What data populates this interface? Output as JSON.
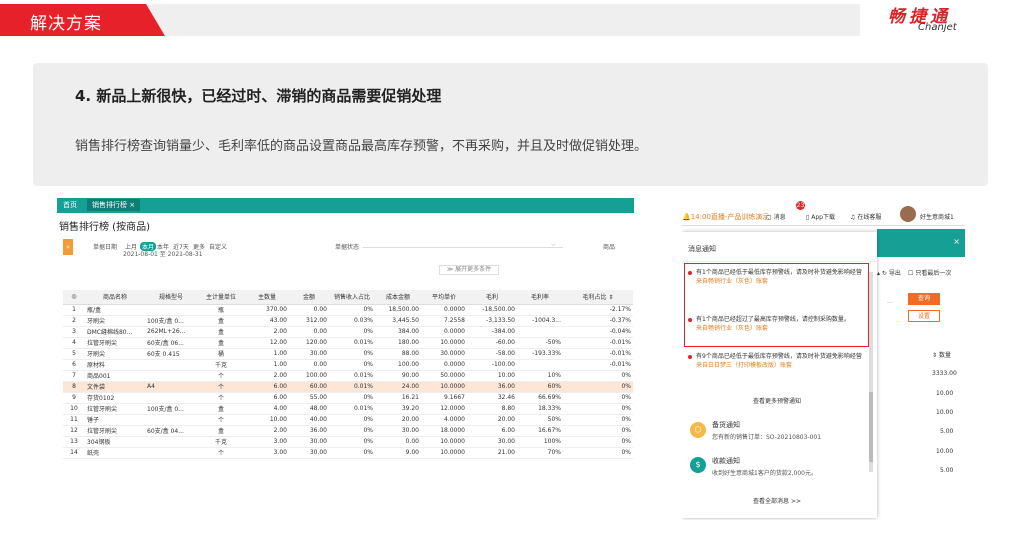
{
  "header": {
    "title": "解决方案",
    "logo_cn": "畅捷通",
    "logo_en": "Chanjet",
    "accent": "#e62129"
  },
  "panel": {
    "heading": "4. 新品上新很快，已经过时、滞销的商品需要促销处理",
    "text": "销售排行榜查询销量少、毛利率低的商品设置商品最高库存预警，不再采购，并且及时做促销处理。"
  },
  "left": {
    "tabs": [
      "首页",
      "销售排行榜 ×"
    ],
    "title": "销售排行榜 (按商品)",
    "filter": {
      "date_label": "单据日期",
      "periods": [
        "上月",
        "本月",
        "本年",
        "近7天",
        "更多",
        "自定义"
      ],
      "range": "2021-08-01 至 2021-08-31",
      "status_label": "单据状态",
      "goods_label": "商品",
      "more": "≫ 展开更多条件"
    },
    "columns": [
      "◎",
      "商品名称",
      "规格型号",
      "主计量单位",
      "主数量",
      "金额",
      "销售收入占比",
      "成本金额",
      "平均单价",
      "毛利",
      "毛利率",
      "毛利占比"
    ],
    "rows": [
      [
        "1",
        "瓶/盒",
        "",
        "瓶",
        "370.00",
        "0.00",
        "0%",
        "18,500.00",
        "0.0000",
        "-18,500.00",
        "",
        "-2.17%"
      ],
      [
        "2",
        "牙刷尖",
        "100支/盒 0...",
        "盒",
        "43.00",
        "312.00",
        "0.03%",
        "3,445.50",
        "7.2558",
        "-3,133.50",
        "-1004.3...",
        "-0.37%"
      ],
      [
        "3",
        "DMC缝棉线80...",
        "262ML+26...",
        "盒",
        "2.00",
        "0.00",
        "0%",
        "384.00",
        "0.0000",
        "-384.00",
        "",
        "-0.04%"
      ],
      [
        "4",
        "拉管牙刷尖",
        "60支/盒 06...",
        "盒",
        "12.00",
        "120.00",
        "0.01%",
        "180.00",
        "10.0000",
        "-60.00",
        "-50%",
        "-0.01%"
      ],
      [
        "5",
        "牙刷尖",
        "60支 0.415",
        "桶",
        "1.00",
        "30.00",
        "0%",
        "88.00",
        "30.0000",
        "-58.00",
        "-193.33%",
        "-0.01%"
      ],
      [
        "6",
        "原材料",
        "",
        "千克",
        "1.00",
        "0.00",
        "0%",
        "100.00",
        "0.0000",
        "-100.00",
        "",
        "-0.01%"
      ],
      [
        "7",
        "商品001",
        "",
        "个",
        "2.00",
        "100.00",
        "0.01%",
        "90.00",
        "50.0000",
        "10.00",
        "10%",
        "0%"
      ],
      [
        "8",
        "文件袋",
        "A4",
        "个",
        "6.00",
        "60.00",
        "0.01%",
        "24.00",
        "10.0000",
        "36.00",
        "60%",
        "0%"
      ],
      [
        "9",
        "存货0102",
        "",
        "个",
        "6.00",
        "55.00",
        "0%",
        "16.21",
        "9.1667",
        "32.46",
        "66.69%",
        "0%"
      ],
      [
        "10",
        "拉管牙刷尖",
        "100支/盒 0...",
        "盒",
        "4.00",
        "48.00",
        "0.01%",
        "39.20",
        "12.0000",
        "8.80",
        "18.33%",
        "0%"
      ],
      [
        "11",
        "锤子",
        "",
        "个",
        "10.00",
        "40.00",
        "0%",
        "20.00",
        "4.0000",
        "20.00",
        "50%",
        "0%"
      ],
      [
        "12",
        "拉管牙刷尖",
        "60支/盒 04...",
        "盒",
        "2.00",
        "36.00",
        "0%",
        "30.00",
        "18.0000",
        "6.00",
        "16.67%",
        "0%"
      ],
      [
        "13",
        "304钢板",
        "",
        "千克",
        "3.00",
        "30.00",
        "0%",
        "0.00",
        "10.0000",
        "30.00",
        "100%",
        "0%"
      ],
      [
        "14",
        "纸壳",
        "",
        "个",
        "3.00",
        "30.00",
        "0%",
        "9.00",
        "10.0000",
        "21.00",
        "70%",
        "0%"
      ]
    ]
  },
  "right": {
    "topbar": {
      "live": "14:00直播-产品训练演示",
      "msg": "消息",
      "badge": "23",
      "app": "App下载",
      "service": "在线客服",
      "user": "好生意商城1"
    },
    "bg": {
      "export": "导出",
      "only_last": "只看最后一次",
      "btn_query": "查询",
      "btn_set": "设置",
      "qty_label": "数量",
      "qtys": [
        "3333.00",
        "10.00",
        "10.00",
        "5.00",
        "10.00",
        "5.00"
      ]
    },
    "popup": {
      "title": "消息通知",
      "notices": [
        {
          "text": "有1个商品已经低于最低库存预警线，请及时补货避免影响经营",
          "source": "来自畅销行业（灰色）账套"
        },
        {
          "text": "有1个商品已经超过了最高库存预警线，请控制采购数量。",
          "source": "来自畅销行业（灰色）账套"
        },
        {
          "text": "有9个商品已经低于最低库存预警线，请及时补货避免影响经营",
          "source": "来自白日梦三（打印模板改版）账套"
        }
      ],
      "more": "查看更多预警通知",
      "sections": [
        {
          "title": "备货通知",
          "sub": "您有新的销售订单：SO-20210803-001"
        },
        {
          "title": "收款通知",
          "sub": "收到好生意商城1客户的货款2,000元。"
        }
      ],
      "all": "查看全部消息 >>"
    }
  }
}
